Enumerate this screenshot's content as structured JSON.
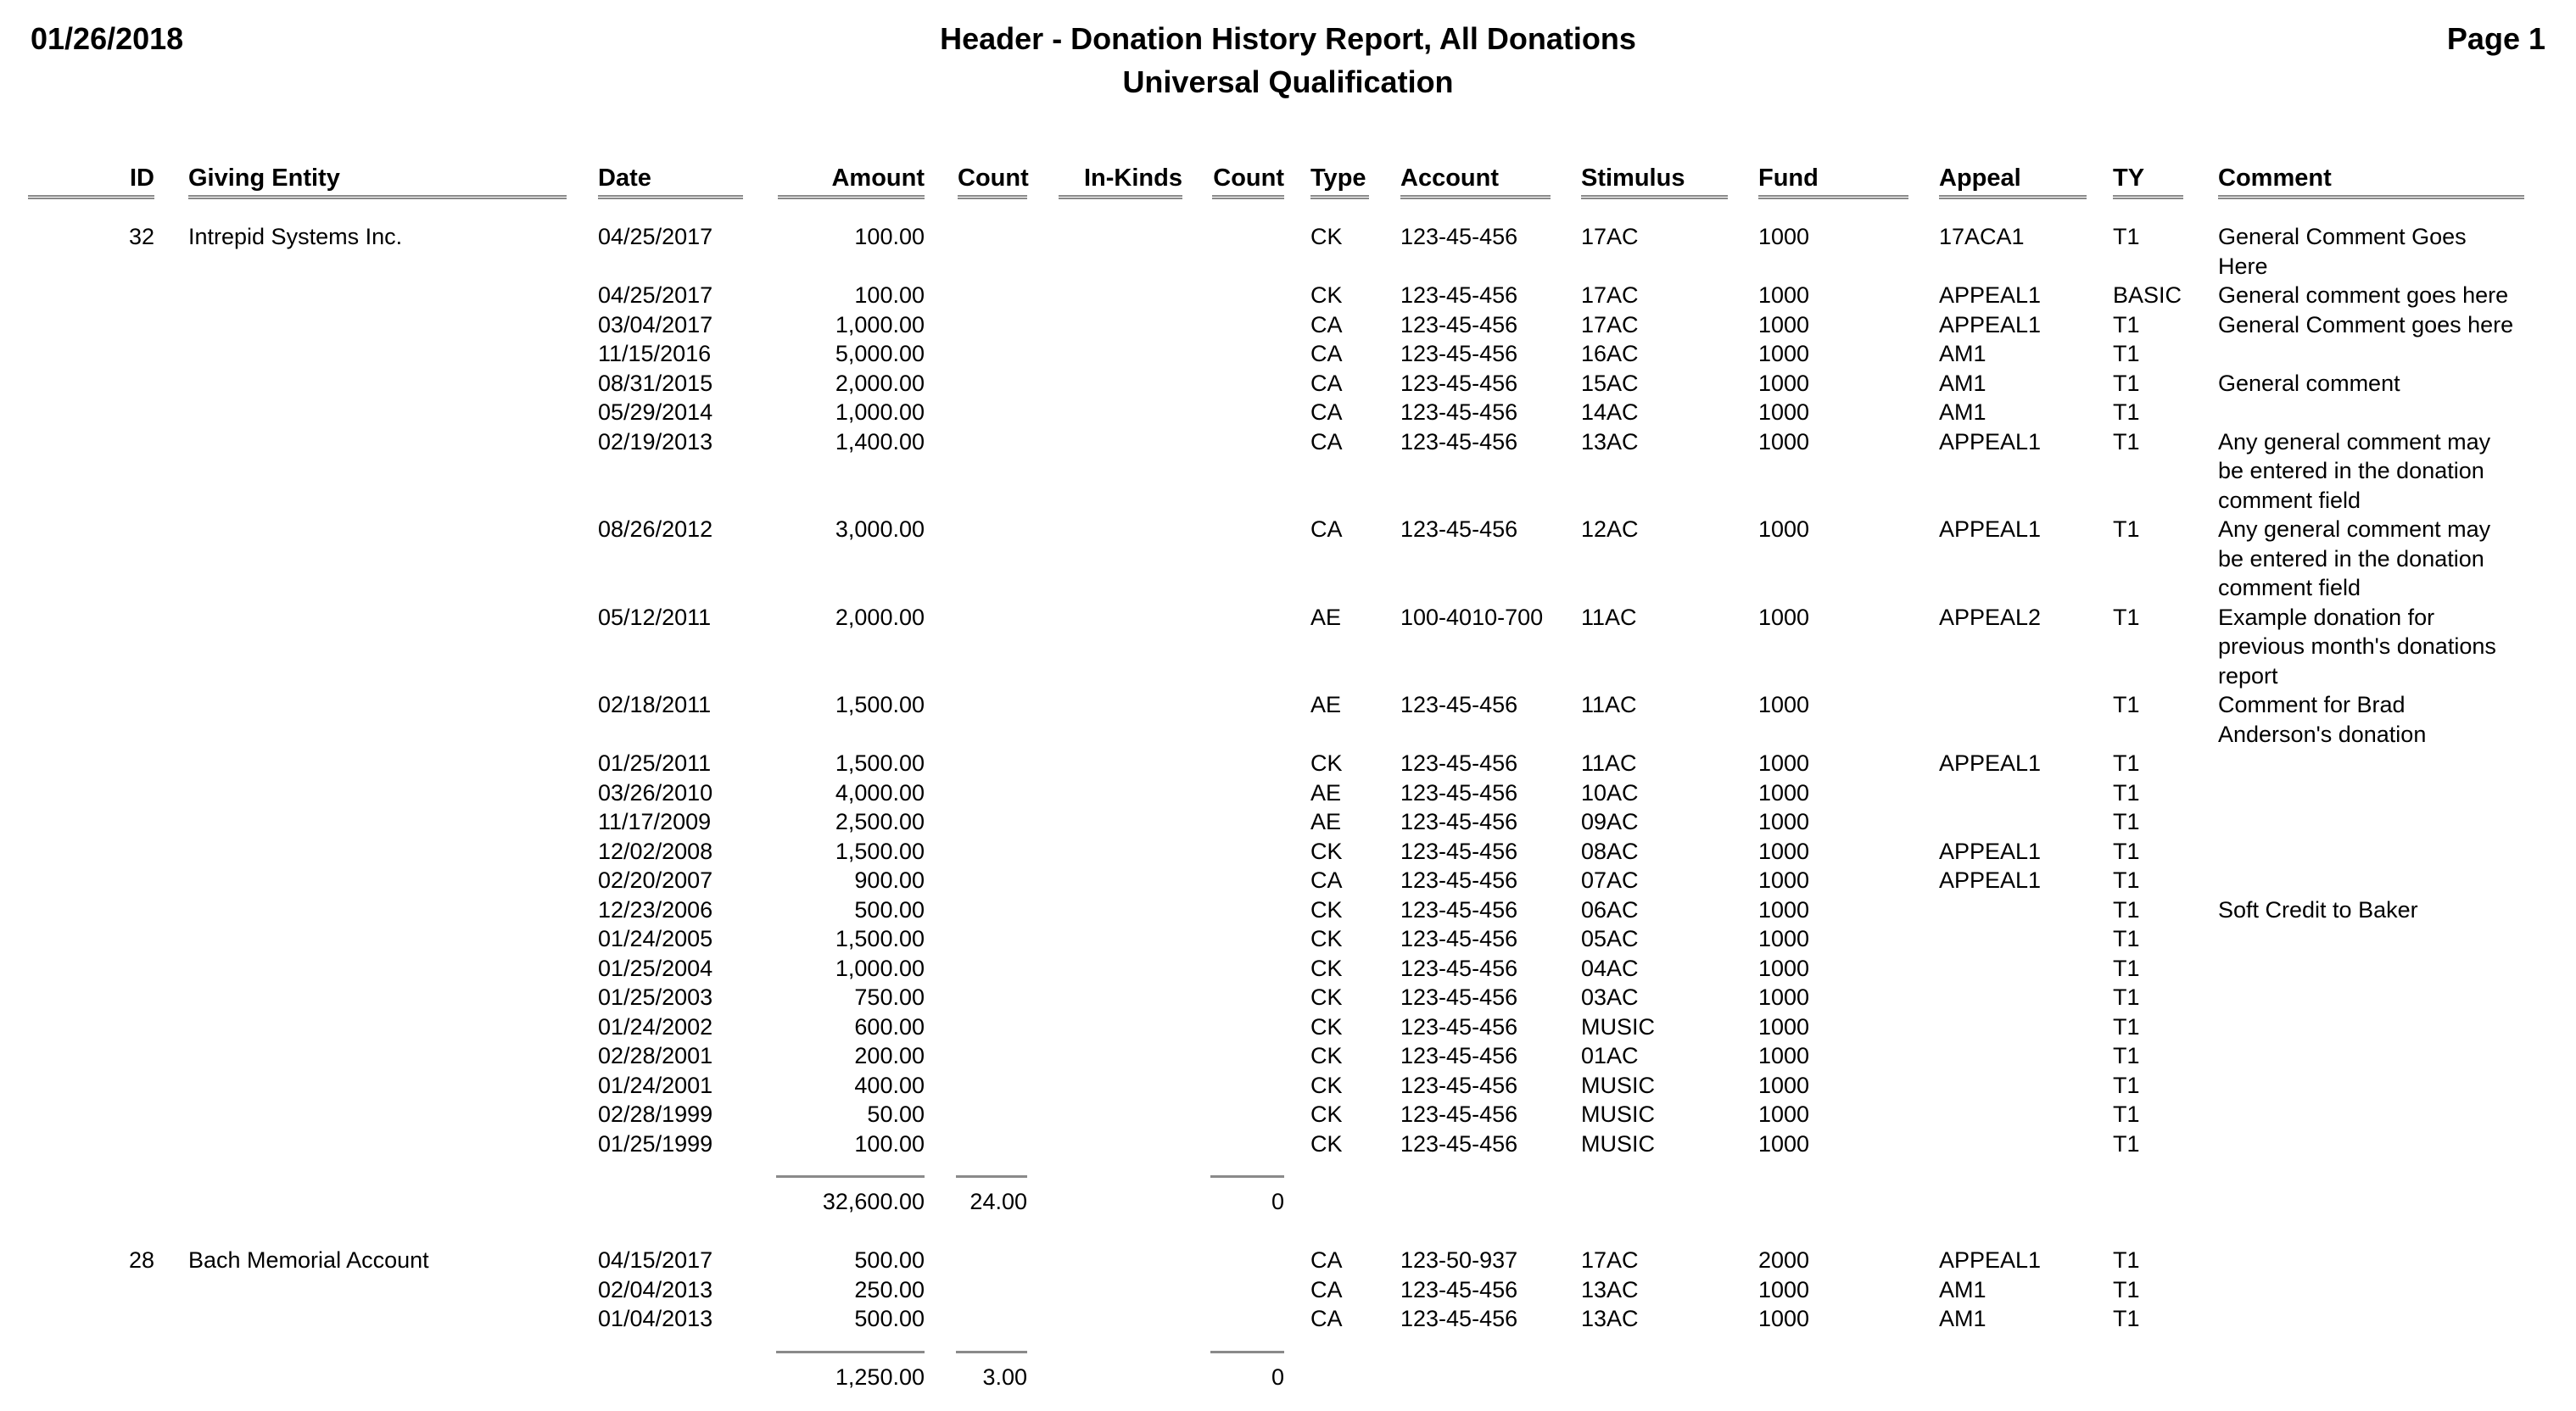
{
  "header": {
    "date": "01/26/2018",
    "title": "Header - Donation History Report, All Donations",
    "subtitle": "Universal Qualification",
    "page": "Page 1"
  },
  "columns": {
    "id": "ID",
    "giving_entity": "Giving Entity",
    "date": "Date",
    "amount": "Amount",
    "count": "Count",
    "in_kinds": "In-Kinds",
    "in_kinds_count": "Count",
    "type": "Type",
    "account": "Account",
    "stimulus": "Stimulus",
    "fund": "Fund",
    "appeal": "Appeal",
    "ty": "TY",
    "comment": "Comment"
  },
  "groups": [
    {
      "id": "32",
      "giving_entity": "Intrepid Systems Inc.",
      "rows": [
        {
          "date": "04/25/2017",
          "amount": "100.00",
          "type": "CK",
          "account": "123-45-456",
          "stimulus": "17AC",
          "fund": "1000",
          "appeal": "17ACA1",
          "ty": "T1",
          "comment": [
            "General Comment Goes",
            "Here"
          ]
        },
        {
          "date": "04/25/2017",
          "amount": "100.00",
          "type": "CK",
          "account": "123-45-456",
          "stimulus": "17AC",
          "fund": "1000",
          "appeal": "APPEAL1",
          "ty": "BASIC",
          "comment": [
            "General comment goes here"
          ]
        },
        {
          "date": "03/04/2017",
          "amount": "1,000.00",
          "type": "CA",
          "account": "123-45-456",
          "stimulus": "17AC",
          "fund": "1000",
          "appeal": "APPEAL1",
          "ty": "T1",
          "comment": [
            "General Comment goes here"
          ]
        },
        {
          "date": "11/15/2016",
          "amount": "5,000.00",
          "type": "CA",
          "account": "123-45-456",
          "stimulus": "16AC",
          "fund": "1000",
          "appeal": "AM1",
          "ty": "T1",
          "comment": []
        },
        {
          "date": "08/31/2015",
          "amount": "2,000.00",
          "type": "CA",
          "account": "123-45-456",
          "stimulus": "15AC",
          "fund": "1000",
          "appeal": "AM1",
          "ty": "T1",
          "comment": [
            "General comment"
          ]
        },
        {
          "date": "05/29/2014",
          "amount": "1,000.00",
          "type": "CA",
          "account": "123-45-456",
          "stimulus": "14AC",
          "fund": "1000",
          "appeal": "AM1",
          "ty": "T1",
          "comment": []
        },
        {
          "date": "02/19/2013",
          "amount": "1,400.00",
          "type": "CA",
          "account": "123-45-456",
          "stimulus": "13AC",
          "fund": "1000",
          "appeal": "APPEAL1",
          "ty": "T1",
          "comment": [
            "Any general comment may",
            "be entered in the donation",
            "comment field"
          ]
        },
        {
          "date": "08/26/2012",
          "amount": "3,000.00",
          "type": "CA",
          "account": "123-45-456",
          "stimulus": "12AC",
          "fund": "1000",
          "appeal": "APPEAL1",
          "ty": "T1",
          "comment": [
            "Any general comment may",
            "be entered in the donation",
            "comment field"
          ]
        },
        {
          "date": "05/12/2011",
          "amount": "2,000.00",
          "type": "AE",
          "account": "100-4010-700",
          "stimulus": "11AC",
          "fund": "1000",
          "appeal": "APPEAL2",
          "ty": "T1",
          "comment": [
            "Example donation for",
            "previous month's donations",
            "report"
          ]
        },
        {
          "date": "02/18/2011",
          "amount": "1,500.00",
          "type": "AE",
          "account": "123-45-456",
          "stimulus": "11AC",
          "fund": "1000",
          "appeal": "",
          "ty": "T1",
          "comment": [
            "Comment for Brad",
            "Anderson's donation"
          ]
        },
        {
          "date": "01/25/2011",
          "amount": "1,500.00",
          "type": "CK",
          "account": "123-45-456",
          "stimulus": "11AC",
          "fund": "1000",
          "appeal": "APPEAL1",
          "ty": "T1",
          "comment": []
        },
        {
          "date": "03/26/2010",
          "amount": "4,000.00",
          "type": "AE",
          "account": "123-45-456",
          "stimulus": "10AC",
          "fund": "1000",
          "appeal": "",
          "ty": "T1",
          "comment": []
        },
        {
          "date": "11/17/2009",
          "amount": "2,500.00",
          "type": "AE",
          "account": "123-45-456",
          "stimulus": "09AC",
          "fund": "1000",
          "appeal": "",
          "ty": "T1",
          "comment": []
        },
        {
          "date": "12/02/2008",
          "amount": "1,500.00",
          "type": "CK",
          "account": "123-45-456",
          "stimulus": "08AC",
          "fund": "1000",
          "appeal": "APPEAL1",
          "ty": "T1",
          "comment": []
        },
        {
          "date": "02/20/2007",
          "amount": "900.00",
          "type": "CA",
          "account": "123-45-456",
          "stimulus": "07AC",
          "fund": "1000",
          "appeal": "APPEAL1",
          "ty": "T1",
          "comment": []
        },
        {
          "date": "12/23/2006",
          "amount": "500.00",
          "type": "CK",
          "account": "123-45-456",
          "stimulus": "06AC",
          "fund": "1000",
          "appeal": "",
          "ty": "T1",
          "comment": [
            "Soft Credit to Baker"
          ]
        },
        {
          "date": "01/24/2005",
          "amount": "1,500.00",
          "type": "CK",
          "account": "123-45-456",
          "stimulus": "05AC",
          "fund": "1000",
          "appeal": "",
          "ty": "T1",
          "comment": []
        },
        {
          "date": "01/25/2004",
          "amount": "1,000.00",
          "type": "CK",
          "account": "123-45-456",
          "stimulus": "04AC",
          "fund": "1000",
          "appeal": "",
          "ty": "T1",
          "comment": []
        },
        {
          "date": "01/25/2003",
          "amount": "750.00",
          "type": "CK",
          "account": "123-45-456",
          "stimulus": "03AC",
          "fund": "1000",
          "appeal": "",
          "ty": "T1",
          "comment": []
        },
        {
          "date": "01/24/2002",
          "amount": "600.00",
          "type": "CK",
          "account": "123-45-456",
          "stimulus": "MUSIC",
          "fund": "1000",
          "appeal": "",
          "ty": "T1",
          "comment": []
        },
        {
          "date": "02/28/2001",
          "amount": "200.00",
          "type": "CK",
          "account": "123-45-456",
          "stimulus": "01AC",
          "fund": "1000",
          "appeal": "",
          "ty": "T1",
          "comment": []
        },
        {
          "date": "01/24/2001",
          "amount": "400.00",
          "type": "CK",
          "account": "123-45-456",
          "stimulus": "MUSIC",
          "fund": "1000",
          "appeal": "",
          "ty": "T1",
          "comment": []
        },
        {
          "date": "02/28/1999",
          "amount": "50.00",
          "type": "CK",
          "account": "123-45-456",
          "stimulus": "MUSIC",
          "fund": "1000",
          "appeal": "",
          "ty": "T1",
          "comment": []
        },
        {
          "date": "01/25/1999",
          "amount": "100.00",
          "type": "CK",
          "account": "123-45-456",
          "stimulus": "MUSIC",
          "fund": "1000",
          "appeal": "",
          "ty": "T1",
          "comment": []
        }
      ],
      "totals": {
        "amount": "32,600.00",
        "count": "24.00",
        "in_kinds_count": "0"
      }
    },
    {
      "id": "28",
      "giving_entity": "Bach Memorial Account",
      "rows": [
        {
          "date": "04/15/2017",
          "amount": "500.00",
          "type": "CA",
          "account": "123-50-937",
          "stimulus": "17AC",
          "fund": "2000",
          "appeal": "APPEAL1",
          "ty": "T1",
          "comment": []
        },
        {
          "date": "02/04/2013",
          "amount": "250.00",
          "type": "CA",
          "account": "123-45-456",
          "stimulus": "13AC",
          "fund": "1000",
          "appeal": "AM1",
          "ty": "T1",
          "comment": []
        },
        {
          "date": "01/04/2013",
          "amount": "500.00",
          "type": "CA",
          "account": "123-45-456",
          "stimulus": "13AC",
          "fund": "1000",
          "appeal": "AM1",
          "ty": "T1",
          "comment": []
        }
      ],
      "totals": {
        "amount": "1,250.00",
        "count": "3.00",
        "in_kinds_count": "0"
      }
    }
  ]
}
